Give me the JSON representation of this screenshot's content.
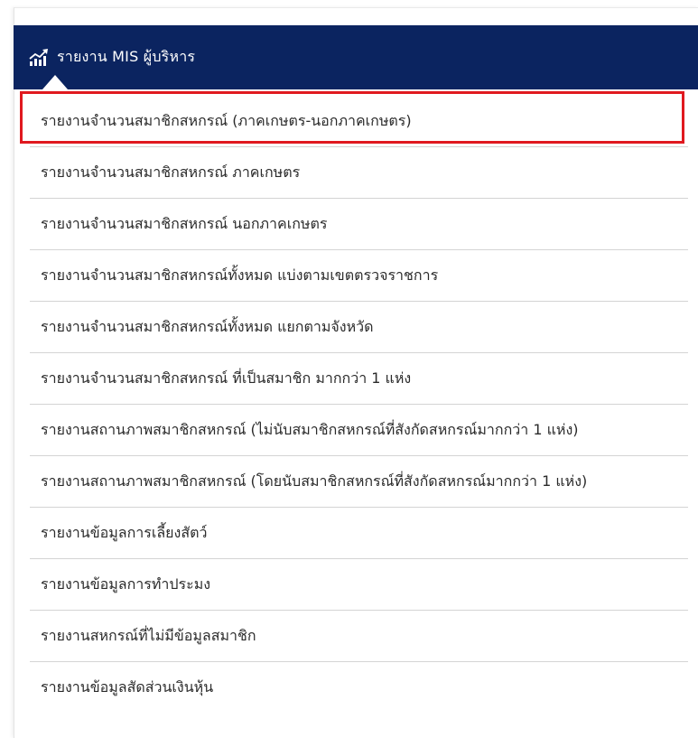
{
  "header": {
    "title": "รายงาน MIS ผู้บริหาร",
    "icon": "chart-icon",
    "background_color": "#0b2460"
  },
  "menu": {
    "items": [
      {
        "label": "รายงานจำนวนสมาชิกสหกรณ์ (ภาคเกษตร-นอกภาคเกษตร)"
      },
      {
        "label": "รายงานจำนวนสมาชิกสหกรณ์ ภาคเกษตร"
      },
      {
        "label": "รายงานจำนวนสมาชิกสหกรณ์ นอกภาคเกษตร"
      },
      {
        "label": "รายงานจำนวนสมาชิกสหกรณ์ทั้งหมด แบ่งตามเขตตรวจราชการ"
      },
      {
        "label": "รายงานจำนวนสมาชิกสหกรณ์ทั้งหมด แยกตามจังหวัด"
      },
      {
        "label": "รายงานจำนวนสมาชิกสหกรณ์ ที่เป็นสมาชิก มากกว่า 1 แห่ง"
      },
      {
        "label": "รายงานสถานภาพสมาชิกสหกรณ์ (ไม่นับสมาชิกสหกรณ์ที่สังกัดสหกรณ์มากกว่า 1 แห่ง)"
      },
      {
        "label": "รายงานสถานภาพสมาชิกสหกรณ์ (โดยนับสมาชิกสหกรณ์ที่สังกัดสหกรณ์มากกว่า 1 แห่ง)"
      },
      {
        "label": "รายงานข้อมูลการเลี้ยงสัตว์"
      },
      {
        "label": "รายงานข้อมูลการทำประมง"
      },
      {
        "label": "รายงานสหกรณ์ที่ไม่มีข้อมูลสมาชิก"
      },
      {
        "label": "รายงานข้อมูลสัดส่วนเงินหุ้น"
      }
    ],
    "highlight_color": "#e0191f"
  }
}
